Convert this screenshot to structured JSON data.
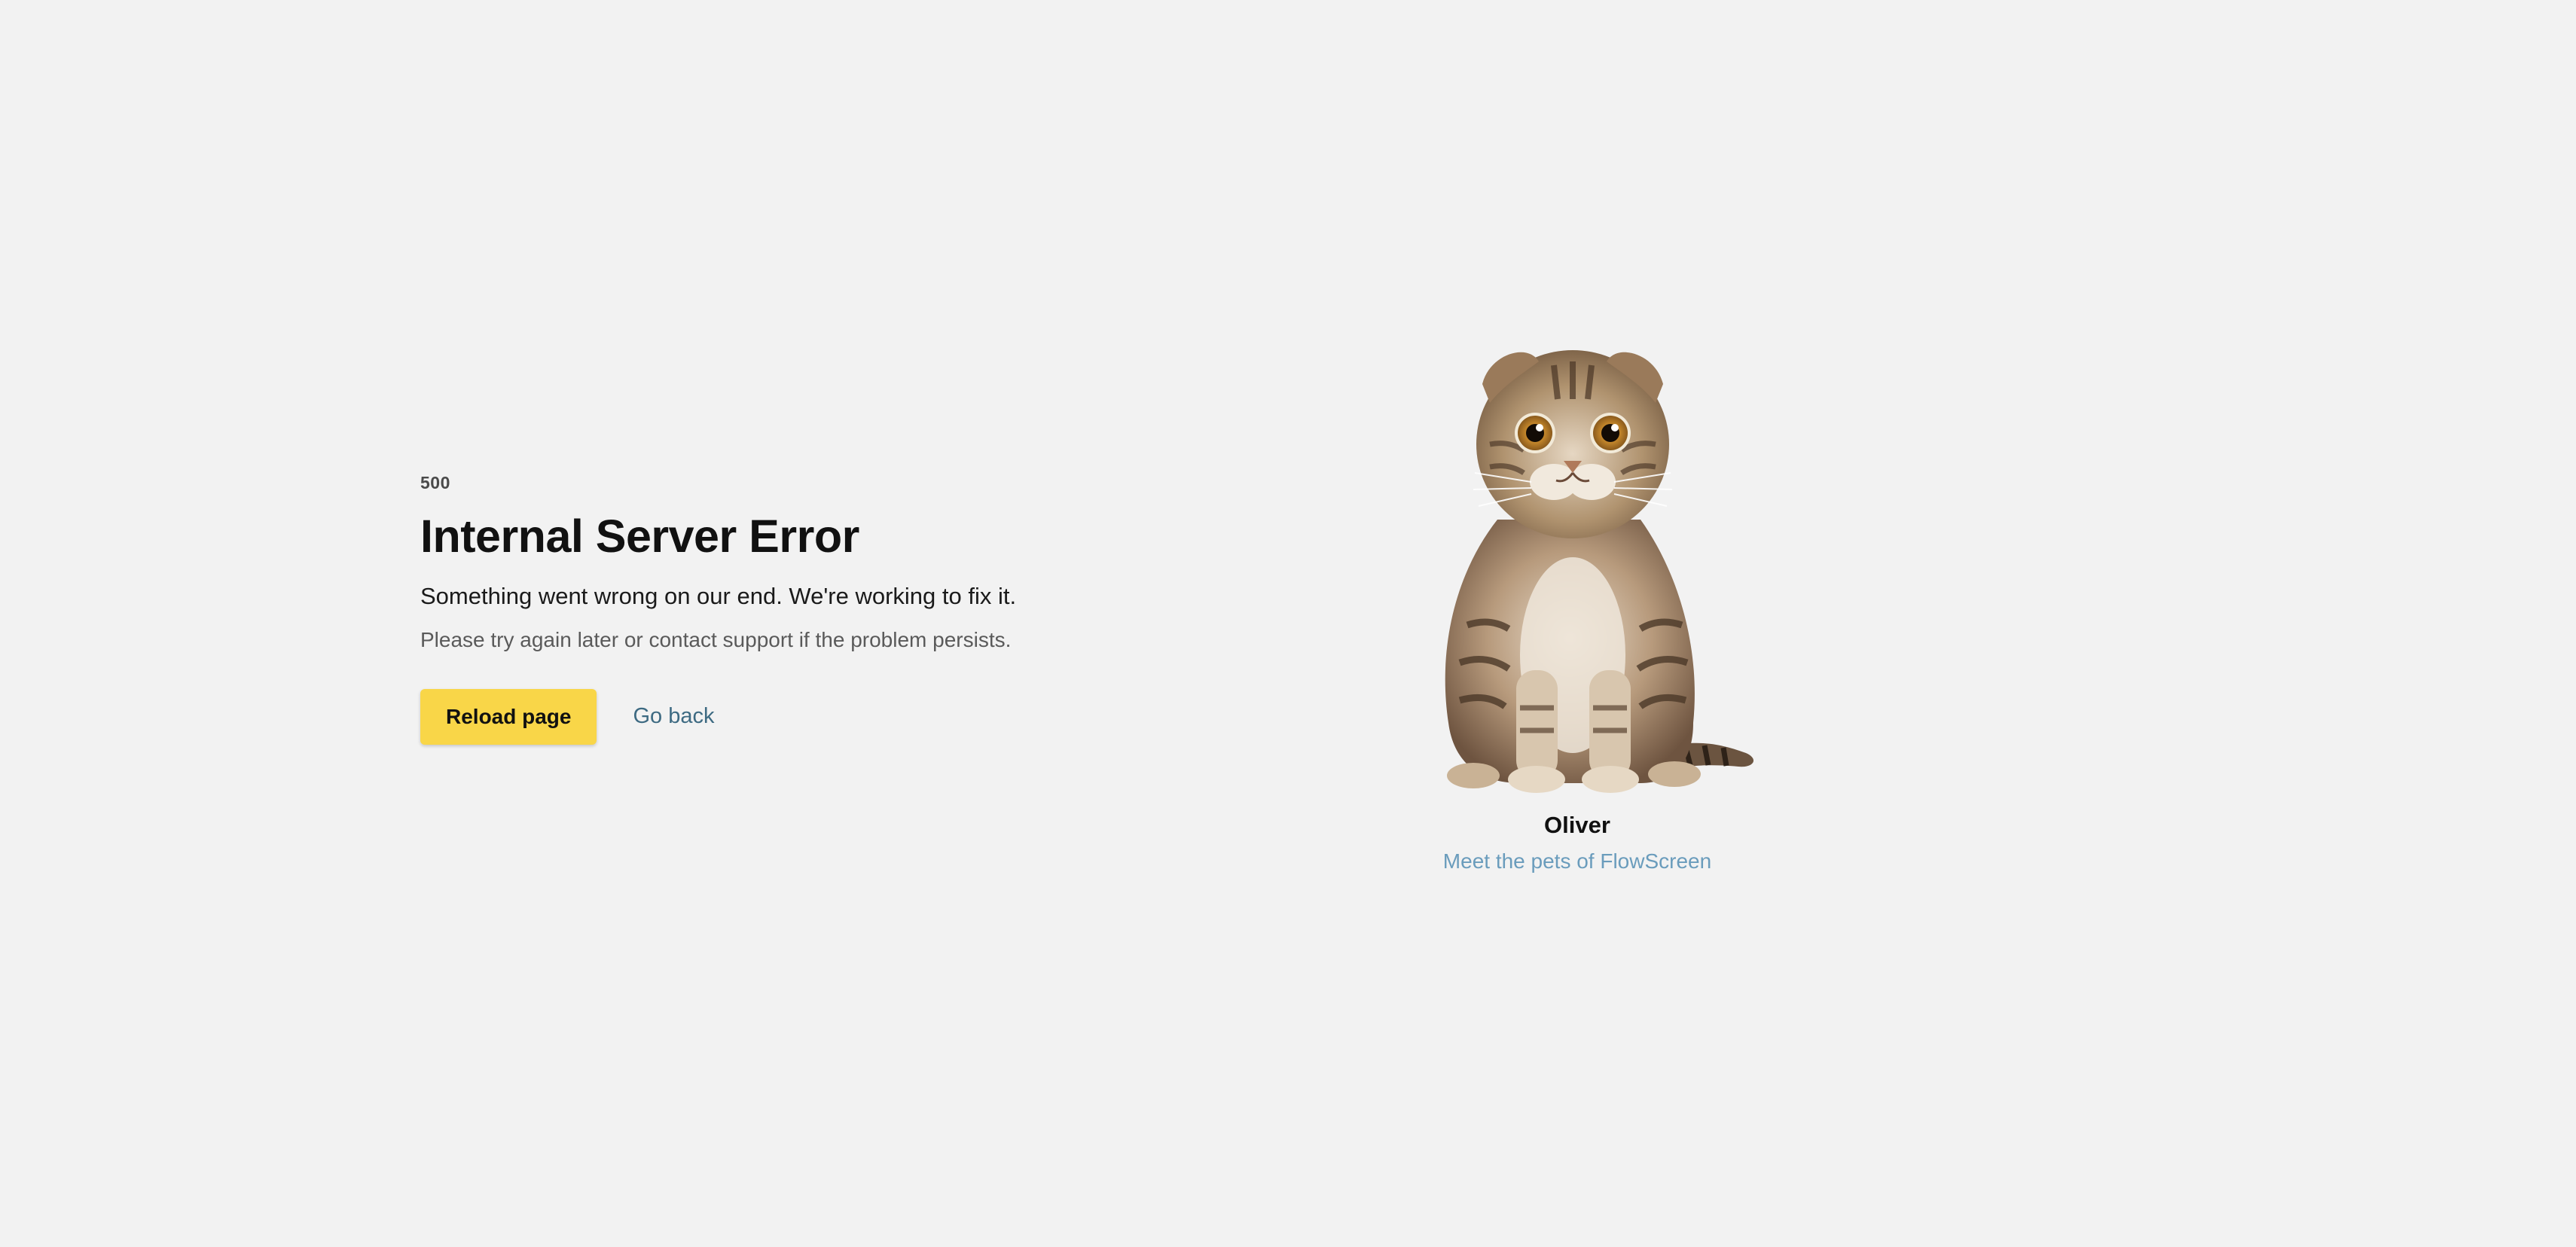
{
  "error": {
    "code": "500",
    "title": "Internal Server Error",
    "message": "Something went wrong on our end. We're working to fix it.",
    "hint": "Please try again later or contact support if the problem persists."
  },
  "actions": {
    "reload_label": "Reload page",
    "back_label": "Go back"
  },
  "pet": {
    "name": "Oliver",
    "link_label": "Meet the pets of FlowScreen",
    "image_icon": "scottish-fold-cat-illustration"
  },
  "colors": {
    "background": "#f2f2f2",
    "button": "#f9d648",
    "back_link": "#3d6a82",
    "pet_link": "#6a9cbc"
  }
}
